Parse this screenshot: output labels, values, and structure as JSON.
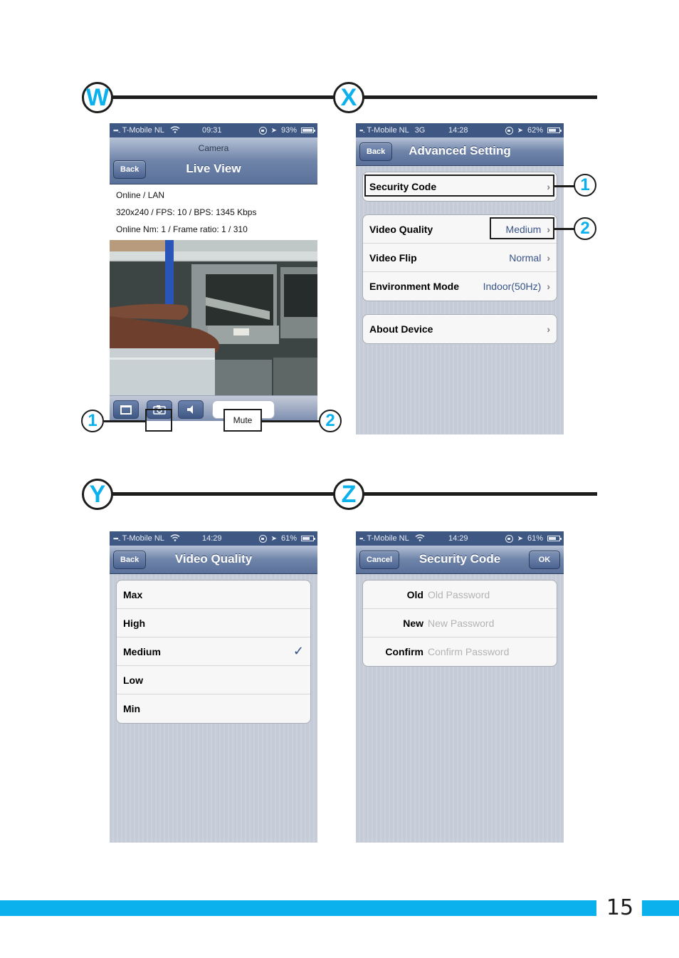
{
  "sections": {
    "w": {
      "letter": "W"
    },
    "x": {
      "letter": "X"
    },
    "y": {
      "letter": "Y"
    },
    "z": {
      "letter": "Z"
    }
  },
  "colors": {
    "accent": "#0ab1ec",
    "nav_bar": "#5a719a",
    "value_blue": "#385487"
  },
  "screen_w": {
    "status": {
      "signal": "▪▪▪..",
      "carrier": "T-Mobile NL",
      "network_icon": "wifi-icon",
      "time": "09:31",
      "battery": "93%",
      "battery_level": 0.93
    },
    "nav": {
      "subtitle": "Camera",
      "title": "Live View",
      "back": "Back"
    },
    "info": [
      "Online / LAN",
      "320x240 / FPS: 10 / BPS: 1345 Kbps",
      "Online Nm: 1 / Frame ratio: 1 / 310"
    ],
    "toolbar": {
      "mute_label": "Mute",
      "buttons": [
        "fullscreen-icon",
        "camera-icon",
        "speaker-icon"
      ]
    },
    "annotations": [
      "1",
      "2"
    ]
  },
  "screen_x": {
    "status": {
      "signal": "▪▪..",
      "carrier": "T-Mobile NL",
      "network": "3G",
      "time": "14:28",
      "battery": "62%",
      "battery_level": 0.62
    },
    "nav": {
      "title": "Advanced Setting",
      "back": "Back"
    },
    "groups": [
      [
        {
          "label": "Security Code",
          "value": ""
        }
      ],
      [
        {
          "label": "Video Quality",
          "value": "Medium"
        },
        {
          "label": "Video Flip",
          "value": "Normal"
        },
        {
          "label": "Environment Mode",
          "value": "Indoor(50Hz)"
        }
      ],
      [
        {
          "label": "About Device",
          "value": ""
        }
      ]
    ],
    "annotations": [
      "1",
      "2"
    ]
  },
  "screen_y": {
    "status": {
      "signal": "▪▪▪..",
      "carrier": "T-Mobile NL",
      "network_icon": "wifi-icon",
      "time": "14:29",
      "battery": "61%",
      "battery_level": 0.61
    },
    "nav": {
      "title": "Video Quality",
      "back": "Back"
    },
    "options": [
      {
        "label": "Max",
        "selected": false
      },
      {
        "label": "High",
        "selected": false
      },
      {
        "label": "Medium",
        "selected": true
      },
      {
        "label": "Low",
        "selected": false
      },
      {
        "label": "Min",
        "selected": false
      }
    ],
    "check_glyph": "✓"
  },
  "screen_z": {
    "status": {
      "signal": "▪▪..",
      "carrier": "T-Mobile NL",
      "network_icon": "wifi-icon",
      "time": "14:29",
      "battery": "61%",
      "battery_level": 0.61
    },
    "nav": {
      "title": "Security Code",
      "cancel": "Cancel",
      "ok": "OK"
    },
    "fields": [
      {
        "label": "Old",
        "placeholder": "Old Password",
        "value": ""
      },
      {
        "label": "New",
        "placeholder": "New Password",
        "value": ""
      },
      {
        "label": "Confirm",
        "placeholder": "Confirm Password",
        "value": ""
      }
    ]
  },
  "footer": {
    "page_number": "15"
  }
}
